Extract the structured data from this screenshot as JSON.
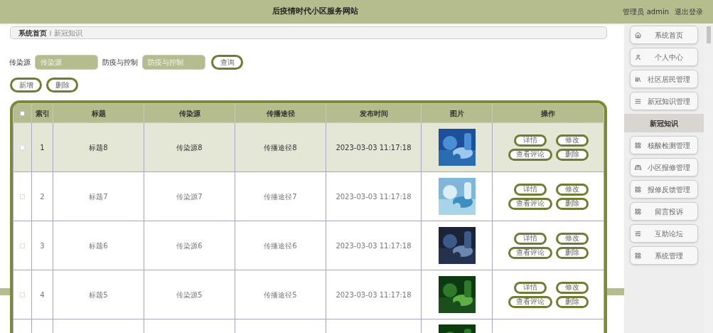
{
  "header": {
    "title": "后疫情时代小区服务网站",
    "user": "管理员 admin",
    "logout": "退出登录"
  },
  "breadcrumb": [
    "系统首页",
    "新冠知识"
  ],
  "search": {
    "fields": [
      {
        "label": "传染源",
        "placeholder": "传染源"
      },
      {
        "label": "防疫与控制",
        "placeholder": "防疫与控制"
      }
    ],
    "button": "查询"
  },
  "actions": [
    "新增",
    "删除"
  ],
  "table": {
    "all_checked": false,
    "columns": [
      "索引",
      "标题",
      "传染源",
      "传播途径",
      "发布时间",
      "图片",
      "操作"
    ],
    "rows": [
      {
        "kind": "full",
        "highlighted": true,
        "checked": false,
        "cells": [
          "1",
          "标题8",
          "传染源8",
          "传播途径8",
          "2023-03-03 11:17:18"
        ],
        "buttons": [
          "详情",
          "修改",
          "查看评论",
          "删除"
        ]
      },
      {
        "kind": "full",
        "highlighted": false,
        "checked": false,
        "cells": [
          "2",
          "标题7",
          "传染源7",
          "传播途径7",
          "2023-03-03 11:17:18"
        ],
        "buttons": [
          "详情",
          "修改",
          "查看评论",
          "删除"
        ]
      },
      {
        "kind": "full",
        "highlighted": false,
        "checked": false,
        "cells": [
          "3",
          "标题6",
          "传染源6",
          "传播途径6",
          "2023-03-03 11:17:18"
        ],
        "buttons": [
          "详情",
          "修改",
          "查看评论",
          "删除"
        ]
      },
      {
        "kind": "full",
        "highlighted": false,
        "checked": false,
        "cells": [
          "4",
          "标题5",
          "传染源5",
          "传播途径5",
          "2023-03-03 11:17:18"
        ],
        "buttons": [
          "详情",
          "修改",
          "查看评论",
          "删除"
        ]
      },
      {
        "kind": "partial"
      }
    ]
  },
  "sidebar": {
    "items": [
      {
        "label": "系统首页"
      },
      {
        "label": "个人中心"
      },
      {
        "label": "社区居民管理"
      },
      {
        "label": "新冠知识管理",
        "children": [
          {
            "label": "新冠知识",
            "selected": true
          }
        ]
      },
      {
        "label": "核酸检测管理"
      },
      {
        "label": "小区报修管理"
      },
      {
        "label": "报修反馈管理"
      },
      {
        "label": "留言投诉"
      },
      {
        "label": "互助论坛"
      },
      {
        "label": "系统管理"
      }
    ]
  }
}
